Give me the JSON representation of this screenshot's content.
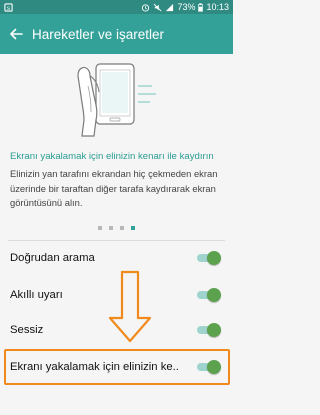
{
  "status_bar": {
    "battery": "73%",
    "time": "10:13",
    "icons": [
      "notification-icon",
      "alarm-icon",
      "silent-icon",
      "signal-icon",
      "battery-icon"
    ]
  },
  "app_bar": {
    "title": "Hareketler ve işaretler",
    "back_icon": "arrow-back-icon"
  },
  "feature": {
    "title": "Ekranı yakalamak için elinizin kenarı ile kaydırın",
    "description": "Elinizin yan tarafını ekrandan hiç çekmeden ekran üzerinde bir taraftan diğer tarafa kaydırarak ekran görüntüsünü alın.",
    "pager": {
      "count": 4,
      "active_index": 3
    }
  },
  "settings": [
    {
      "label": "Doğrudan arama",
      "enabled": true
    },
    {
      "label": "Akıllı uyarı",
      "enabled": true
    },
    {
      "label": "Sessiz",
      "enabled": true
    },
    {
      "label": "Ekranı yakalamak için elinizin ke..",
      "enabled": true
    }
  ],
  "colors": {
    "status_bar": "#2f8a82",
    "app_bar": "#34a198",
    "accent": "#2a9d93",
    "toggle_thumb": "#5ca14d",
    "toggle_track": "#9fd3ce",
    "annotation": "#f08a1c"
  }
}
